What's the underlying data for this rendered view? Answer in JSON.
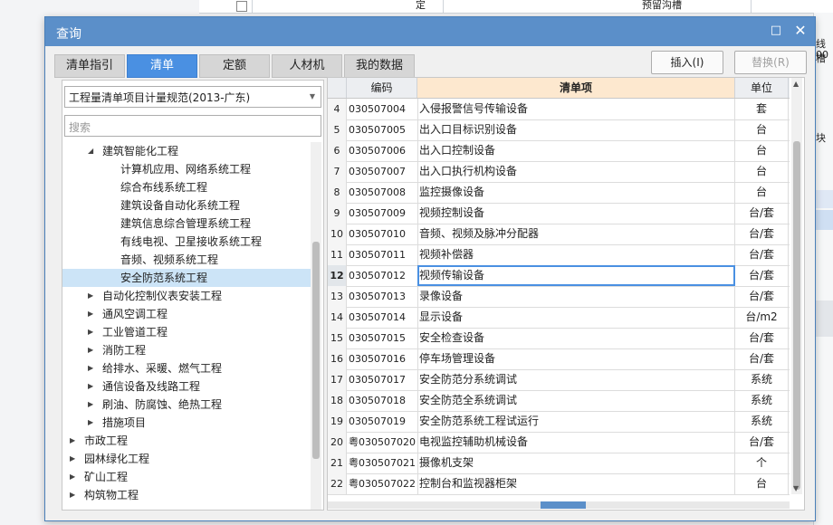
{
  "background": {
    "top_cells": [
      "定",
      "预留沟槽"
    ],
    "right_labels": [
      "线槽",
      "00",
      "块"
    ]
  },
  "dialog": {
    "title": "查询",
    "maximize_icon": "maximize-icon",
    "close_icon": "close-icon",
    "tabs": [
      {
        "label": "清单指引",
        "active": false
      },
      {
        "label": "清单",
        "active": true
      },
      {
        "label": "定额",
        "active": false
      },
      {
        "label": "人材机",
        "active": false
      },
      {
        "label": "我的数据",
        "active": false
      }
    ],
    "insert_button": "插入(I)",
    "replace_button": "替换(R)"
  },
  "left": {
    "spec_select": "工程量清单项目计量规范(2013-广东)",
    "search_placeholder": "搜索",
    "tree": [
      {
        "label": "建筑智能化工程",
        "level": 1,
        "expander": "expanded"
      },
      {
        "label": "计算机应用、网络系统工程",
        "level": 2,
        "expander": "none"
      },
      {
        "label": "综合布线系统工程",
        "level": 2,
        "expander": "none"
      },
      {
        "label": "建筑设备自动化系统工程",
        "level": 2,
        "expander": "none"
      },
      {
        "label": "建筑信息综合管理系统工程",
        "level": 2,
        "expander": "none"
      },
      {
        "label": "有线电视、卫星接收系统工程",
        "level": 2,
        "expander": "none"
      },
      {
        "label": "音频、视频系统工程",
        "level": 2,
        "expander": "none"
      },
      {
        "label": "安全防范系统工程",
        "level": 2,
        "expander": "none",
        "selected": true
      },
      {
        "label": "自动化控制仪表安装工程",
        "level": 1,
        "expander": "collapsed"
      },
      {
        "label": "通风空调工程",
        "level": 1,
        "expander": "collapsed"
      },
      {
        "label": "工业管道工程",
        "level": 1,
        "expander": "collapsed"
      },
      {
        "label": "消防工程",
        "level": 1,
        "expander": "collapsed"
      },
      {
        "label": "给排水、采暖、燃气工程",
        "level": 1,
        "expander": "collapsed"
      },
      {
        "label": "通信设备及线路工程",
        "level": 1,
        "expander": "collapsed"
      },
      {
        "label": "刷油、防腐蚀、绝热工程",
        "level": 1,
        "expander": "collapsed"
      },
      {
        "label": "措施项目",
        "level": 1,
        "expander": "collapsed"
      },
      {
        "label": "市政工程",
        "level": 0,
        "expander": "collapsed"
      },
      {
        "label": "园林绿化工程",
        "level": 0,
        "expander": "collapsed"
      },
      {
        "label": "矿山工程",
        "level": 0,
        "expander": "collapsed"
      },
      {
        "label": "构筑物工程",
        "level": 0,
        "expander": "collapsed"
      }
    ]
  },
  "grid": {
    "columns": {
      "code": "编码",
      "item": "清单项",
      "unit": "单位"
    },
    "rows": [
      {
        "no": "4",
        "code": "030507004",
        "name": "入侵报警信号传输设备",
        "unit": "套"
      },
      {
        "no": "5",
        "code": "030507005",
        "name": "出入口目标识别设备",
        "unit": "台"
      },
      {
        "no": "6",
        "code": "030507006",
        "name": "出入口控制设备",
        "unit": "台"
      },
      {
        "no": "7",
        "code": "030507007",
        "name": "出入口执行机构设备",
        "unit": "台"
      },
      {
        "no": "8",
        "code": "030507008",
        "name": "监控摄像设备",
        "unit": "台"
      },
      {
        "no": "9",
        "code": "030507009",
        "name": "视频控制设备",
        "unit": "台/套"
      },
      {
        "no": "10",
        "code": "030507010",
        "name": "音频、视频及脉冲分配器",
        "unit": "台/套"
      },
      {
        "no": "11",
        "code": "030507011",
        "name": "视频补偿器",
        "unit": "台/套"
      },
      {
        "no": "12",
        "code": "030507012",
        "name": "视频传输设备",
        "unit": "台/套",
        "current": true
      },
      {
        "no": "13",
        "code": "030507013",
        "name": "录像设备",
        "unit": "台/套"
      },
      {
        "no": "14",
        "code": "030507014",
        "name": "显示设备",
        "unit": "台/m2"
      },
      {
        "no": "15",
        "code": "030507015",
        "name": "安全检查设备",
        "unit": "台/套"
      },
      {
        "no": "16",
        "code": "030507016",
        "name": "停车场管理设备",
        "unit": "台/套"
      },
      {
        "no": "17",
        "code": "030507017",
        "name": "安全防范分系统调试",
        "unit": "系统"
      },
      {
        "no": "18",
        "code": "030507018",
        "name": "安全防范全系统调试",
        "unit": "系统"
      },
      {
        "no": "19",
        "code": "030507019",
        "name": "安全防范系统工程试运行",
        "unit": "系统"
      },
      {
        "no": "20",
        "code": "粤030507020",
        "name": "电视监控辅助机械设备",
        "unit": "台/套"
      },
      {
        "no": "21",
        "code": "粤030507021",
        "name": "摄像机支架",
        "unit": "个"
      },
      {
        "no": "22",
        "code": "粤030507022",
        "name": "控制台和监视器柜架",
        "unit": "台"
      }
    ]
  },
  "colors": {
    "accent": "#4a90e2",
    "title_bar": "#5b8fc9",
    "header_highlight": "#fde8cf",
    "selection": "#cce4f7"
  }
}
